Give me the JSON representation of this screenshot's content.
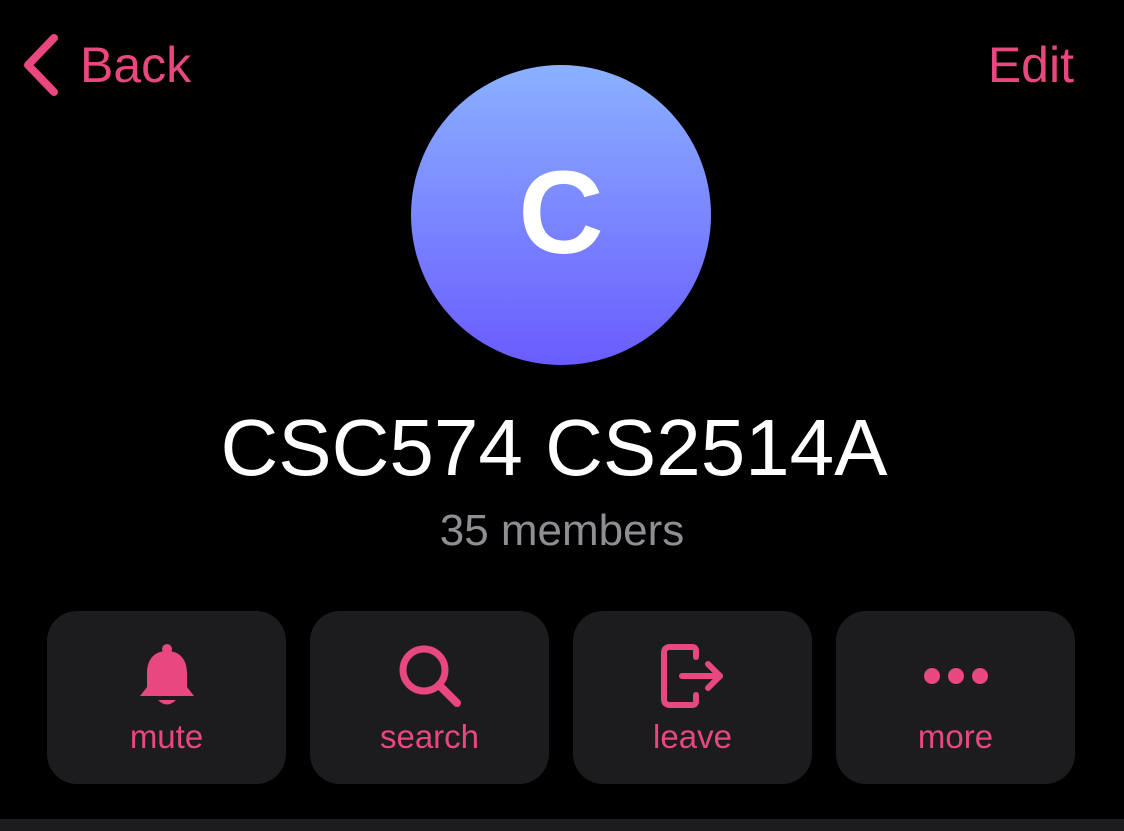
{
  "nav": {
    "back_label": "Back",
    "edit_label": "Edit"
  },
  "avatar": {
    "letter": "C"
  },
  "group": {
    "name": "CSC574 CS2514A",
    "members": "35 members"
  },
  "actions": [
    {
      "label": "mute",
      "icon": "bell-icon"
    },
    {
      "label": "search",
      "icon": "search-icon"
    },
    {
      "label": "leave",
      "icon": "leave-icon"
    },
    {
      "label": "more",
      "icon": "ellipsis-icon"
    }
  ],
  "colors": {
    "accent": "#e8477f",
    "background": "#000000",
    "card": "#1c1c1e",
    "secondary_text": "#8e8e93",
    "avatar_top": "#8bb1ff",
    "avatar_bottom": "#6a5cff"
  }
}
